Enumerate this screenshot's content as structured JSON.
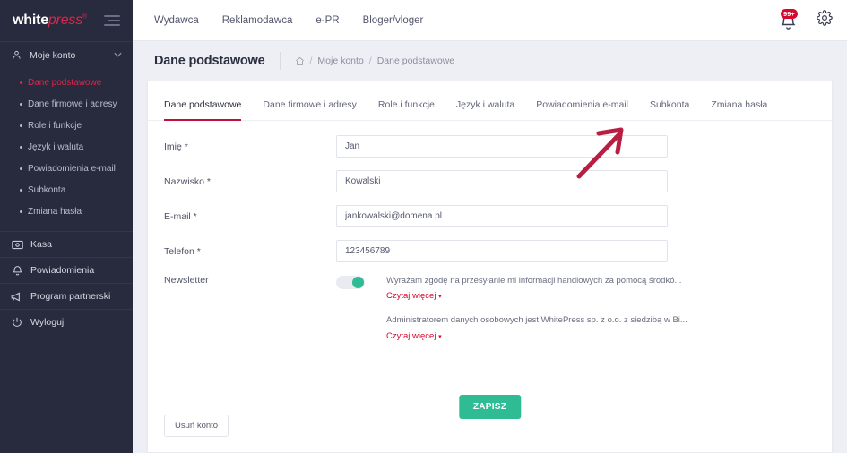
{
  "brand": {
    "logo_white": "white",
    "logo_press": "press",
    "logo_reg": "®",
    "accent_red": "#d6082e",
    "accent_green": "#2fbb94",
    "sidebar_bg": "#282b3d"
  },
  "sidebar": {
    "account": {
      "label": "Moje konto",
      "icon": "user-icon",
      "chevron": "chevron-down-icon"
    },
    "subitems": [
      {
        "label": "Dane podstawowe",
        "active": true
      },
      {
        "label": "Dane firmowe i adresy",
        "active": false
      },
      {
        "label": "Role i funkcje",
        "active": false
      },
      {
        "label": "Język i waluta",
        "active": false
      },
      {
        "label": "Powiadomienia e-mail",
        "active": false
      },
      {
        "label": "Subkonta",
        "active": false
      },
      {
        "label": "Zmiana hasła",
        "active": false
      }
    ],
    "bottom_items": [
      {
        "label": "Kasa",
        "icon": "wallet-icon"
      },
      {
        "label": "Powiadomienia",
        "icon": "bell-icon"
      },
      {
        "label": "Program partnerski",
        "icon": "megaphone-icon"
      },
      {
        "label": "Wyloguj",
        "icon": "power-icon"
      }
    ]
  },
  "topbar": {
    "nav": [
      {
        "label": "Wydawca"
      },
      {
        "label": "Reklamodawca"
      },
      {
        "label": "e-PR"
      },
      {
        "label": "Bloger/vloger"
      }
    ],
    "notifications": {
      "icon": "bell-icon",
      "badge": "99+"
    },
    "settings": {
      "icon": "gear-icon"
    }
  },
  "page": {
    "title": "Dane podstawowe",
    "breadcrumb": {
      "home_icon": "home-icon",
      "items": [
        "Moje konto",
        "Dane podstawowe"
      ],
      "separator": "/"
    }
  },
  "tabs": [
    {
      "label": "Dane podstawowe",
      "active": true
    },
    {
      "label": "Dane firmowe i adresy",
      "active": false
    },
    {
      "label": "Role i funkcje",
      "active": false
    },
    {
      "label": "Język i waluta",
      "active": false
    },
    {
      "label": "Powiadomienia e-mail",
      "active": false
    },
    {
      "label": "Subkonta",
      "active": false
    },
    {
      "label": "Zmiana hasła",
      "active": false
    }
  ],
  "form": {
    "fields": [
      {
        "label": "Imię *",
        "value": "Jan",
        "placeholder": "Imię"
      },
      {
        "label": "Nazwisko *",
        "value": "Kowalski",
        "placeholder": "Nazwisko"
      },
      {
        "label": "E-mail *",
        "value": "jankowalski@domena.pl",
        "placeholder": "E-mail"
      },
      {
        "label": "Telefon *",
        "value": "123456789",
        "placeholder": "Telefon"
      }
    ],
    "newsletter": {
      "label": "Newsletter",
      "toggle_state": "on",
      "consents": [
        {
          "text": "Wyrażam zgodę na przesyłanie mi informacji handlowych za pomocą środkó...",
          "more_label": "Czytaj więcej",
          "more_caret": "▾"
        },
        {
          "text": "Administratorem danych osobowych jest WhitePress sp. z o.o. z siedzibą w Bi...",
          "more_label": "Czytaj więcej",
          "more_caret": "▾"
        }
      ]
    },
    "save_button": "ZAPISZ",
    "delete_button": "Usuń konto"
  },
  "annotation": {
    "type": "arrow",
    "color": "#b81d42",
    "points_to": "Subkonta"
  }
}
